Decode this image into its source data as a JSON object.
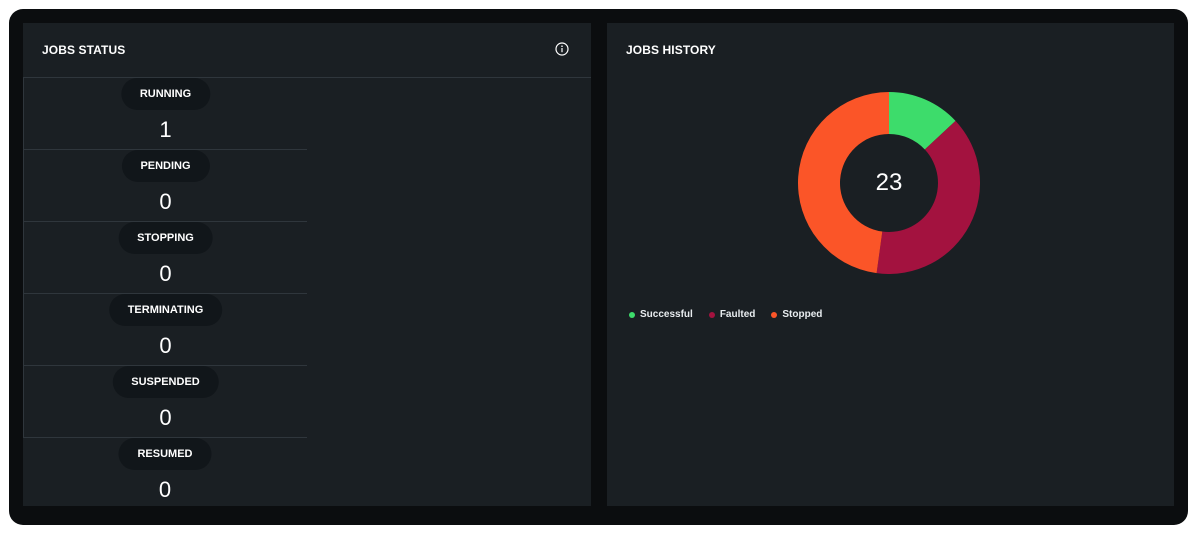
{
  "jobs_status": {
    "title": "JOBS STATUS",
    "info_icon": "info-circle-icon",
    "items": [
      {
        "label": "RUNNING",
        "count": "1"
      },
      {
        "label": "PENDING",
        "count": "0"
      },
      {
        "label": "STOPPING",
        "count": "0"
      },
      {
        "label": "TERMINATING",
        "count": "0"
      },
      {
        "label": "SUSPENDED",
        "count": "0"
      },
      {
        "label": "RESUMED",
        "count": "0"
      }
    ]
  },
  "jobs_history": {
    "title": "JOBS HISTORY",
    "total": "23"
  },
  "chart_data": {
    "type": "pie",
    "title": "JOBS HISTORY",
    "center_label": "23",
    "categories": [
      "Successful",
      "Faulted",
      "Stopped"
    ],
    "values": [
      3,
      9,
      11
    ],
    "colors": [
      "#3ddc6b",
      "#a3123f",
      "#fb5528"
    ],
    "legend_position": "bottom-left"
  },
  "colors": {
    "background": "#0b0d0f",
    "panel": "#1a1f23",
    "pill": "#11161a",
    "divider": "#2f363c"
  }
}
